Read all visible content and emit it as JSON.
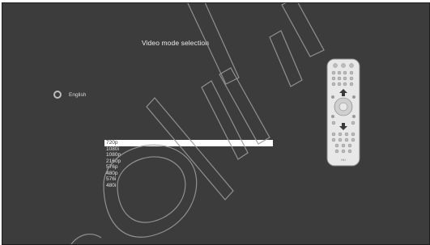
{
  "screen": {
    "title": "Video mode selection",
    "language": {
      "label": "English"
    },
    "video_modes": {
      "selected_index": 0,
      "options": [
        "720p",
        "1080i",
        "1080p",
        "2160p",
        "576p",
        "480p",
        "576i",
        "480i"
      ]
    },
    "remote": {
      "brand_text": "HU"
    }
  },
  "colors": {
    "background": "#3c3c3c",
    "text": "#e2e2e2",
    "highlight": "#ffffff",
    "watermark": "#9a9a9a"
  }
}
